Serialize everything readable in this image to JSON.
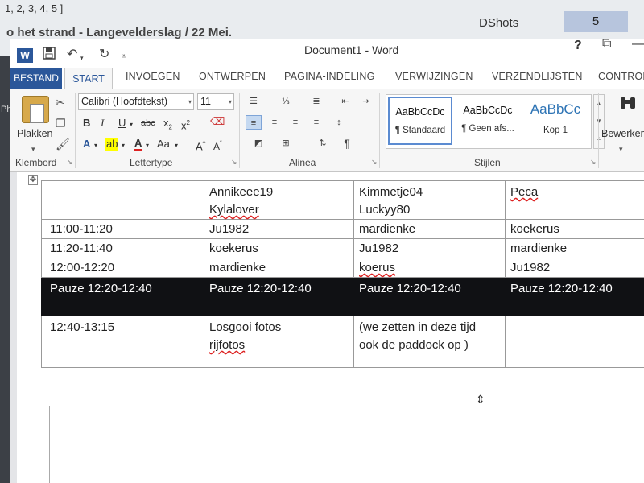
{
  "background": {
    "top_text": "1, 2, 3, 4, 5 ]",
    "heading_text": "o het strand - Langevelderslag / 22 Mei.",
    "cell_label": "DShots",
    "cell_value": "5",
    "left_strip_text": "Ph"
  },
  "window": {
    "title": "Document1 - Word",
    "help": "?",
    "restore": "⧉",
    "minimize": "—"
  },
  "tabs": {
    "file": "BESTAND",
    "active": "START",
    "items": [
      "INVOEGEN",
      "ONTWERPEN",
      "PAGINA-INDELING",
      "VERWIJZINGEN",
      "VERZENDLIJSTEN",
      "CONTROL"
    ]
  },
  "ribbon": {
    "clipboard": {
      "paste_label": "Plakken",
      "group_label": "Klembord"
    },
    "font": {
      "family": "Calibri (Hoofdtekst)",
      "size": "11",
      "group_label": "Lettertype"
    },
    "paragraph": {
      "group_label": "Alinea"
    },
    "styles": {
      "group_label": "Stijlen",
      "items": [
        {
          "preview": "AaBbCcDc",
          "name": "¶ Standaard"
        },
        {
          "preview": "AaBbCcDc",
          "name": "¶ Geen afs..."
        },
        {
          "preview": "AaBbCc",
          "name": "Kop 1"
        }
      ]
    },
    "editing": {
      "label": "Bewerken"
    }
  },
  "table": {
    "header": [
      "",
      "Annikeee19\nKylalover",
      "Kimmetje04\nLuckyy80",
      "Peca"
    ],
    "rows": [
      [
        "11:00-11:20",
        "Ju1982",
        "mardienke",
        "koekerus"
      ],
      [
        "11:20-11:40",
        "koekerus",
        "Ju1982",
        "mardienke"
      ],
      [
        "12:00-12:20",
        "mardienke",
        "koerus",
        "Ju1982"
      ]
    ],
    "pause": [
      "Pauze 12:20-12:40",
      "Pauze 12:20-12:40",
      "Pauze 12:20-12:40",
      "Pauze 12:20-12:40"
    ],
    "last": [
      "12:40-13:15",
      "Losgooi fotos\nrijfotos",
      "(we zetten in deze tijd\nook de paddock op )",
      ""
    ]
  }
}
